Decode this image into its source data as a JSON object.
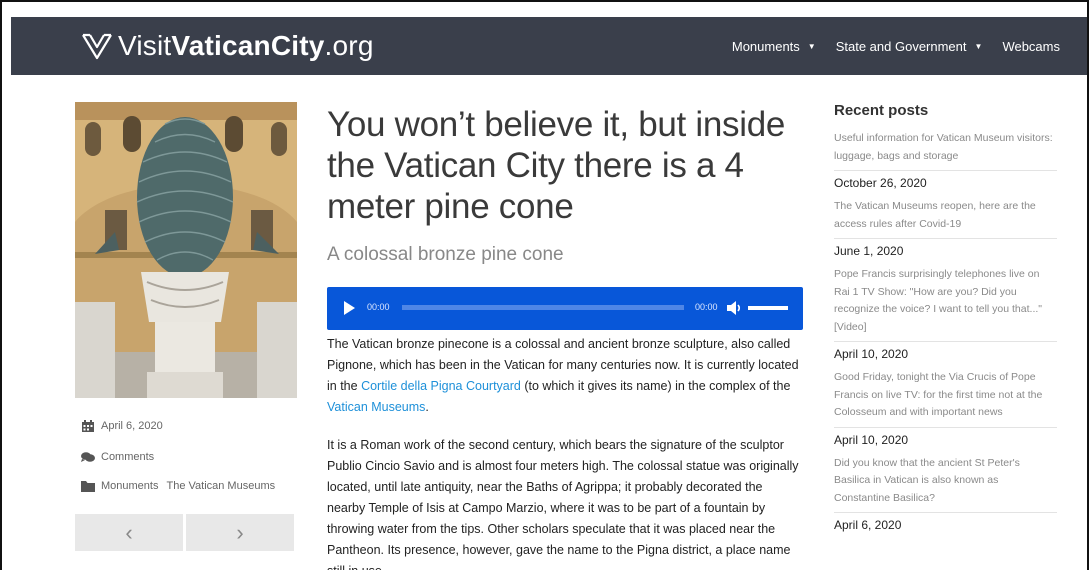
{
  "header": {
    "logo": {
      "prefix": "Visit",
      "bold": "VaticanCity",
      "suffix": ".org"
    },
    "nav": [
      {
        "label": "Monuments",
        "dropdown": true
      },
      {
        "label": "State and Government",
        "dropdown": true
      },
      {
        "label": "Webcams",
        "dropdown": false
      }
    ]
  },
  "post": {
    "title": "You won’t believe it, but inside the Vatican City there is a 4 meter pine cone",
    "subtitle": "A colossal bronze pine cone",
    "audio": {
      "current_time": "00:00",
      "duration": "00:00"
    },
    "paragraph1": {
      "t1": "The Vatican bronze pinecone is a colossal and ancient bronze sculpture, also called Pignone, which has been in the Vatican for many centuries now. It is currently located in the ",
      "link1": "Cortile della Pigna Courtyard",
      "t2": " (to which it gives its name) in the complex of the ",
      "link2": "Vatican Museums",
      "t3": "."
    },
    "paragraph2": "It is a Roman work of the second century, which bears the signature of the sculptor Publio Cincio Savio and is almost four meters high. The colossal statue was originally located, until late antiquity, near the Baths of Agrippa; it probably decorated the nearby Temple of Isis at Campo Marzio, where it was to be part of a fountain by throwing water from the tips. Other scholars speculate that it was placed near the Pantheon. Its presence, however, gave the name to the Pigna district, a place name still in use."
  },
  "meta": {
    "date": "April 6, 2020",
    "comments": "Comments",
    "categories": [
      "Monuments",
      "The Vatican Museums"
    ]
  },
  "pager": {
    "prev": "‹",
    "next": "›"
  },
  "sidebar": {
    "title": "Recent posts",
    "posts": [
      {
        "title": "Useful information for Vatican Museum visitors: luggage, bags and storage",
        "date": "October 26, 2020"
      },
      {
        "title": "The Vatican Museums reopen, here are the access rules after Covid-19",
        "date": "June 1, 2020"
      },
      {
        "title": "Pope Francis surprisingly telephones live on Rai 1 TV Show: \"How are you? Did you recognize the voice? I want to tell you that...\" [Video]",
        "date": "April 10, 2020"
      },
      {
        "title": "Good Friday, tonight the Via Crucis of Pope Francis on live TV: for the first time not at the Colosseum and with important news",
        "date": "April 10, 2020"
      },
      {
        "title": "Did you know that the ancient St Peter's Basilica in Vatican is also known as Constantine Basilica?",
        "date": "April 6, 2020"
      }
    ]
  },
  "icons": {
    "logo": "vaticancity-logo-icon",
    "date": "calendar-icon",
    "comments": "comments-icon",
    "category": "folder-icon",
    "play": "play-icon",
    "volume": "volume-icon"
  },
  "colors": {
    "navbar": "#3a3f4b",
    "player": "#0857d9",
    "link": "#1e90d9"
  }
}
